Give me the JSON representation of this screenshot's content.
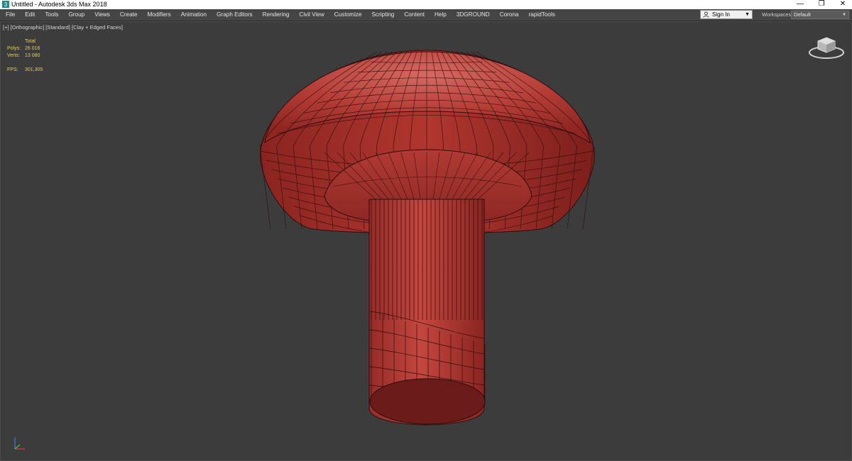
{
  "titlebar": {
    "title": "Untitled - Autodesk 3ds Max 2018",
    "minimize_glyph": "—",
    "maximize_glyph": "❐",
    "close_glyph": "✕"
  },
  "menu": {
    "items": [
      "File",
      "Edit",
      "Tools",
      "Group",
      "Views",
      "Create",
      "Modifiers",
      "Animation",
      "Graph Editors",
      "Rendering",
      "Civil View",
      "Customize",
      "Scripting",
      "Content",
      "Help",
      "3DGROUND",
      "Corona",
      "rapidTools"
    ],
    "signin_label": "Sign In",
    "signin_caret": "▼",
    "workspaces_label": "Workspaces:",
    "workspaces_value": "Default",
    "workspaces_caret": "▼"
  },
  "viewport": {
    "label_plus": "[+]",
    "label_view": "[Orthographic]",
    "label_shading": "[Standard]",
    "label_mode": "[Clay + Edged Faces]",
    "stats": {
      "total_header": "Total",
      "polys_label": "Polys:",
      "polys_value": "26 016",
      "verts_label": "Verts:",
      "verts_value": "13 080",
      "fps_label": "FPS:",
      "fps_value": "301,305"
    }
  },
  "colors": {
    "model_fill": "#b23a34",
    "model_shadow": "#6e1c1a",
    "wire": "#2a0d0c",
    "stats_text": "#e6d246",
    "viewport_bg": "#3c3c3c"
  },
  "icons": {
    "app": "3ds-max-icon",
    "user": "user-icon",
    "viewcube": "viewcube-icon",
    "axis": "axis-tripod-icon"
  }
}
